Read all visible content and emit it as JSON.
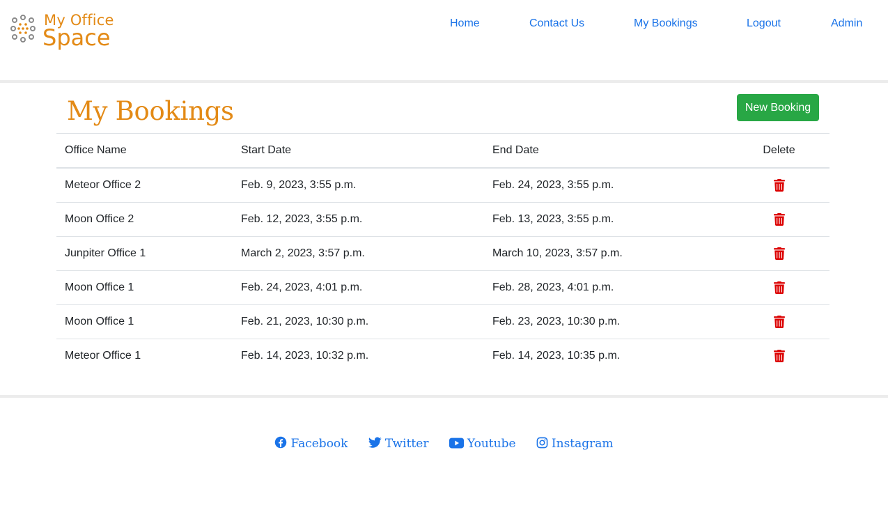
{
  "brand": {
    "line1": "My Office",
    "line2": "Space",
    "color": "#e38a16"
  },
  "nav": [
    {
      "label": "Home"
    },
    {
      "label": "Contact Us"
    },
    {
      "label": "My Bookings"
    },
    {
      "label": "Logout"
    },
    {
      "label": "Admin"
    }
  ],
  "page": {
    "title": "My Bookings",
    "new_booking_label": "New Booking"
  },
  "table": {
    "headers": [
      "Office Name",
      "Start Date",
      "End Date",
      "Delete"
    ],
    "rows": [
      {
        "office": "Meteor Office 2",
        "start": "Feb. 9, 2023, 3:55 p.m.",
        "end": "Feb. 24, 2023, 3:55 p.m.",
        "delete_icon": "trash-icon"
      },
      {
        "office": "Moon Office 2",
        "start": "Feb. 12, 2023, 3:55 p.m.",
        "end": "Feb. 13, 2023, 3:55 p.m.",
        "delete_icon": "trash-icon"
      },
      {
        "office": "Junpiter Office 1",
        "start": "March 2, 2023, 3:57 p.m.",
        "end": "March 10, 2023, 3:57 p.m.",
        "delete_icon": "trash-icon"
      },
      {
        "office": "Moon Office 1",
        "start": "Feb. 24, 2023, 4:01 p.m.",
        "end": "Feb. 28, 2023, 4:01 p.m.",
        "delete_icon": "trash-icon"
      },
      {
        "office": "Moon Office 1",
        "start": "Feb. 21, 2023, 10:30 p.m.",
        "end": "Feb. 23, 2023, 10:30 p.m.",
        "delete_icon": "trash-icon"
      },
      {
        "office": "Meteor Office 1",
        "start": "Feb. 14, 2023, 10:32 p.m.",
        "end": "Feb. 14, 2023, 10:35 p.m.",
        "delete_icon": "trash-icon"
      }
    ]
  },
  "footer": {
    "links": [
      {
        "label": "Facebook",
        "icon": "facebook-icon"
      },
      {
        "label": "Twitter",
        "icon": "twitter-icon"
      },
      {
        "label": "Youtube",
        "icon": "youtube-icon"
      },
      {
        "label": "Instagram",
        "icon": "instagram-icon"
      }
    ]
  },
  "colors": {
    "accent": "#e38a16",
    "link": "#1a73e8",
    "success": "#28a745",
    "danger": "#dc0000"
  }
}
